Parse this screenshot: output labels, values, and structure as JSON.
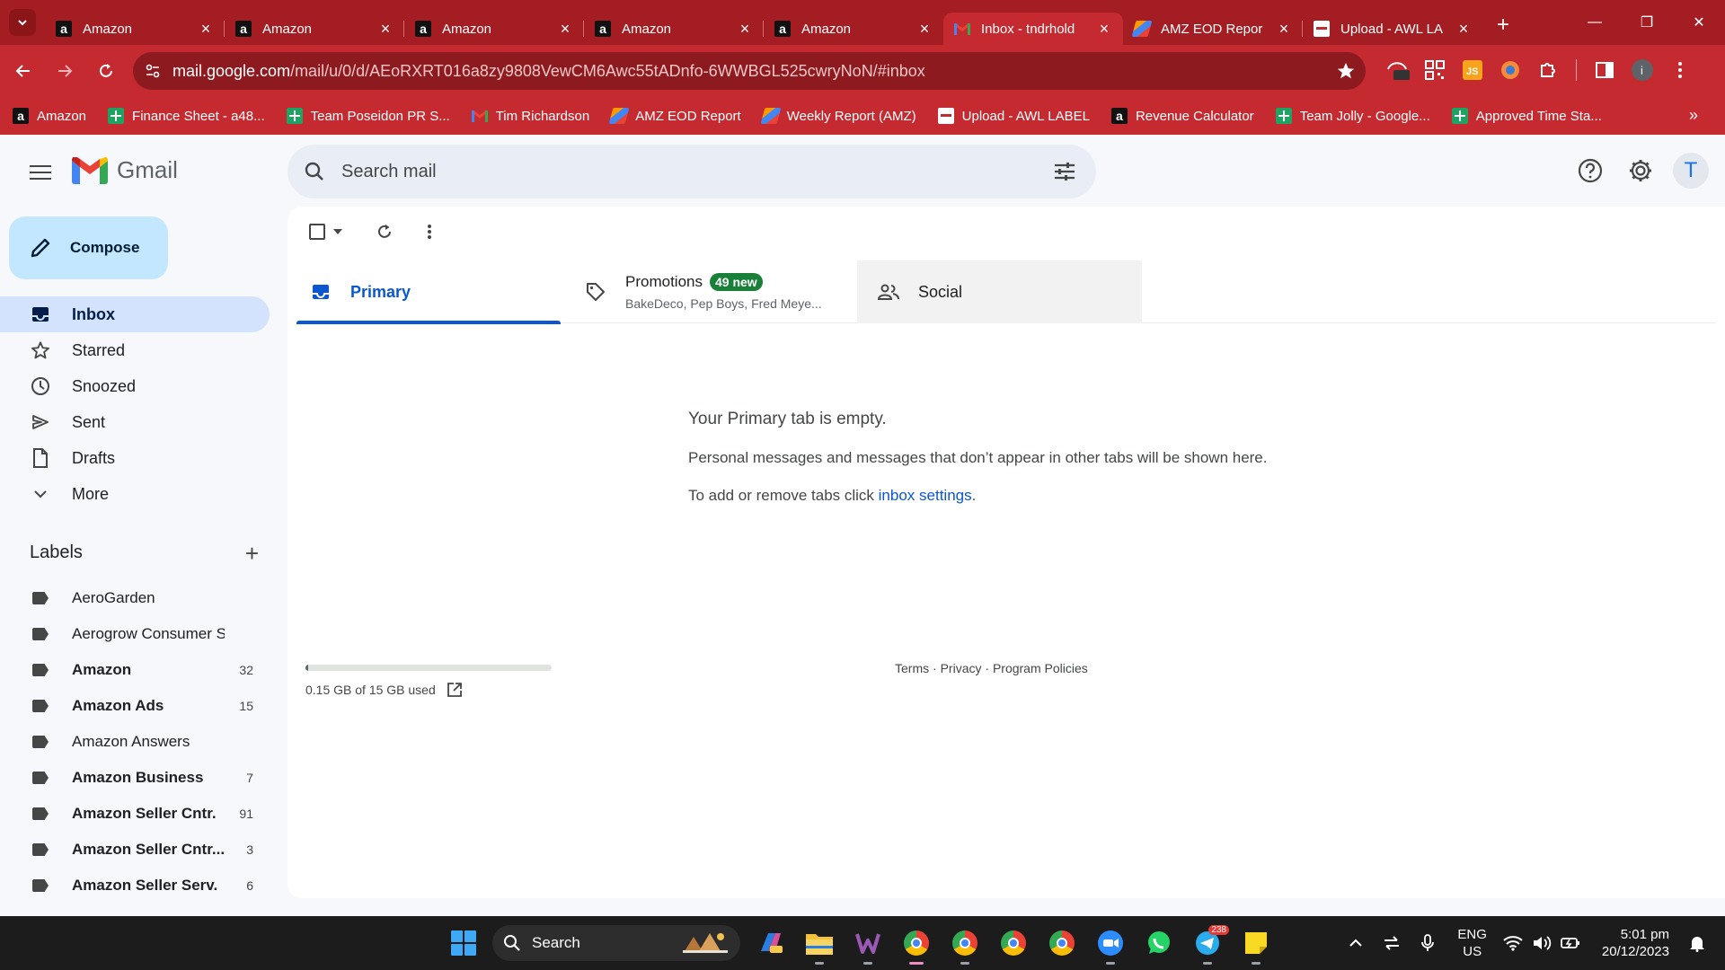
{
  "browser": {
    "tabs": [
      {
        "title": "Amazon",
        "favicon": "amazon-icon",
        "active": false
      },
      {
        "title": "Amazon",
        "favicon": "amazon-icon",
        "active": false
      },
      {
        "title": "Amazon",
        "favicon": "amazon-icon",
        "active": false
      },
      {
        "title": "Amazon",
        "favicon": "amazon-icon",
        "active": false
      },
      {
        "title": "Amazon",
        "favicon": "amazon-icon",
        "active": false
      },
      {
        "title": "Inbox - tndrhold",
        "favicon": "gmail-icon",
        "active": true
      },
      {
        "title": "AMZ EOD Repor",
        "favicon": "report-icon",
        "active": false
      },
      {
        "title": "Upload - AWL LA",
        "favicon": "awl-icon",
        "active": false
      }
    ],
    "url_host": "mail.google.com",
    "url_path": "/mail/u/0/d/AEoRXRT016a8zy9808VewCM6Awc55tADnfo-6WWBGL525cwryNoN/#inbox",
    "extension_off_badge": "Off",
    "profile_initial": "i",
    "bookmarks": [
      {
        "label": "Amazon",
        "icon": "amazon-icon"
      },
      {
        "label": "Finance Sheet - a48...",
        "icon": "sheets-icon"
      },
      {
        "label": "Team Poseidon PR S...",
        "icon": "sheets-icon"
      },
      {
        "label": "Tim Richardson",
        "icon": "gmail-icon"
      },
      {
        "label": "AMZ EOD Report",
        "icon": "report-icon"
      },
      {
        "label": "Weekly Report (AMZ)",
        "icon": "report-icon"
      },
      {
        "label": "Upload - AWL LABEL",
        "icon": "awl-icon"
      },
      {
        "label": "Revenue Calculator",
        "icon": "amazon-icon"
      },
      {
        "label": "Team Jolly - Google...",
        "icon": "sheets-icon"
      },
      {
        "label": "Approved Time Sta...",
        "icon": "sheets-icon"
      }
    ],
    "colors": {
      "chrome_red": "#c42a2f",
      "tabstrip": "#a41d22"
    }
  },
  "gmail": {
    "product_name": "Gmail",
    "search_placeholder": "Search mail",
    "avatar_initial": "T",
    "compose_label": "Compose",
    "nav": [
      {
        "label": "Inbox",
        "icon": "inbox-icon",
        "active": true
      },
      {
        "label": "Starred",
        "icon": "star-icon",
        "active": false
      },
      {
        "label": "Snoozed",
        "icon": "clock-icon",
        "active": false
      },
      {
        "label": "Sent",
        "icon": "send-icon",
        "active": false
      },
      {
        "label": "Drafts",
        "icon": "draft-icon",
        "active": false
      },
      {
        "label": "More",
        "icon": "chevron-down-icon",
        "active": false
      }
    ],
    "labels_heading": "Labels",
    "labels": [
      {
        "name": "AeroGarden",
        "count": "",
        "bold": false
      },
      {
        "name": "Aerogrow Consumer Se...",
        "count": "",
        "bold": false
      },
      {
        "name": "Amazon",
        "count": "32",
        "bold": true
      },
      {
        "name": "Amazon Ads",
        "count": "15",
        "bold": true
      },
      {
        "name": "Amazon Answers",
        "count": "",
        "bold": false
      },
      {
        "name": "Amazon Business",
        "count": "7",
        "bold": true
      },
      {
        "name": "Amazon Seller Cntr.",
        "count": "91",
        "bold": true
      },
      {
        "name": "Amazon Seller Cntr...",
        "count": "3",
        "bold": true
      },
      {
        "name": "Amazon Seller Serv.",
        "count": "6",
        "bold": true
      }
    ],
    "tabs": {
      "primary": "Primary",
      "promotions": "Promotions",
      "promotions_badge": "49 new",
      "promotions_senders": "BakeDeco, Pep Boys, Fred Meye...",
      "social": "Social"
    },
    "empty_title": "Your Primary tab is empty.",
    "empty_desc": "Personal messages and messages that don’t appear in other tabs will be shown here.",
    "empty_hint_prefix": "To add or remove tabs click ",
    "empty_hint_link": "inbox settings",
    "empty_hint_suffix": ".",
    "storage_text": "0.15 GB of 15 GB used",
    "storage_fraction": 0.01,
    "footer": {
      "terms": "Terms",
      "privacy": "Privacy",
      "policies": "Program Policies",
      "sep": " · "
    },
    "colors": {
      "accent": "#0b57d0",
      "compose_bg": "#c2e7ff",
      "active_nav": "#d3e3fd",
      "badge": "#188038"
    }
  },
  "taskbar": {
    "search_label": "Search",
    "telegram_badge": "238",
    "lang_1": "ENG",
    "lang_2": "US",
    "time": "5:01 pm",
    "date": "20/12/2023"
  }
}
